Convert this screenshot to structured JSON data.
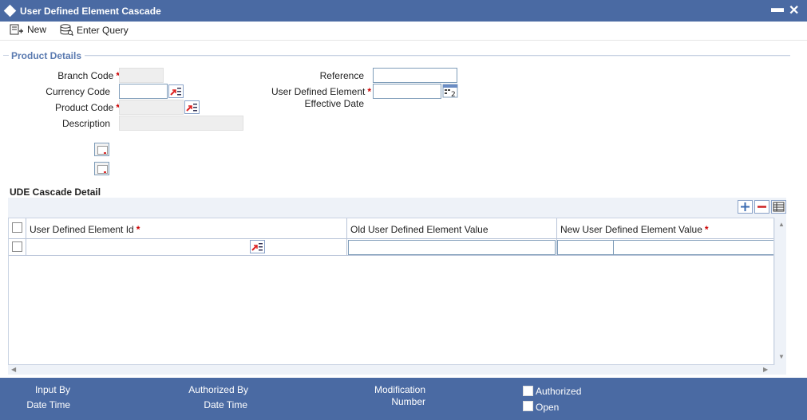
{
  "window": {
    "title": "User Defined Element Cascade",
    "minimize": "▬",
    "close": "✕"
  },
  "toolbar": {
    "new_label": "New",
    "enter_query_label": "Enter Query"
  },
  "product_details": {
    "section_title": "Product Details",
    "branch_code_label": "Branch Code",
    "currency_code_label": "Currency Code",
    "product_code_label": "Product Code",
    "description_label": "Description",
    "reference_label": "Reference",
    "ude_effective_date_label_line1": "User Defined Element",
    "ude_effective_date_label_line2": "Effective Date",
    "required_mark": "*",
    "branch_code_value": "",
    "currency_code_value": "",
    "product_code_value": "",
    "description_value": "",
    "reference_value": "",
    "ude_effective_date_value": ""
  },
  "cascade_detail": {
    "section_title": "UDE Cascade Detail",
    "columns": [
      "User Defined Element Id",
      "Old User Defined Element Value",
      "New User Defined Element Value"
    ],
    "rows": [
      {
        "ude_id": "",
        "old_value": "",
        "new_value": ""
      }
    ]
  },
  "footer": {
    "input_by": "Input By",
    "date_time_1": "Date Time",
    "authorized_by": "Authorized By",
    "date_time_2": "Date Time",
    "modification": "Modification",
    "number": "Number",
    "authorized": "Authorized",
    "open": "Open"
  },
  "colors": {
    "titlebar": "#4a6aa3",
    "footer": "#4a6aa3",
    "section_title": "#5a7ab0",
    "required": "#cc0000"
  }
}
